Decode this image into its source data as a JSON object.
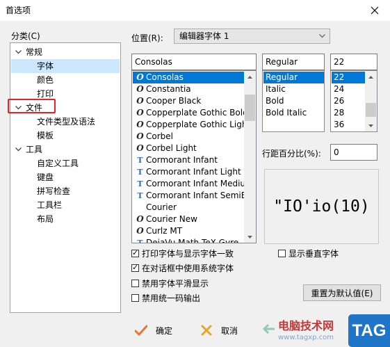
{
  "window": {
    "title": "首选项"
  },
  "category_label": "分类(C)",
  "tree": [
    {
      "label": "常规",
      "expanded": true,
      "items": [
        {
          "label": "字体",
          "selected": true
        },
        {
          "label": "颜色"
        },
        {
          "label": "打印"
        }
      ]
    },
    {
      "label": "文件",
      "expanded": true,
      "items": [
        {
          "label": "文件类型及语法"
        },
        {
          "label": "模板"
        }
      ]
    },
    {
      "label": "工具",
      "expanded": true,
      "items": [
        {
          "label": "自定义工具"
        },
        {
          "label": "键盘"
        },
        {
          "label": "拼写检查"
        },
        {
          "label": "工具栏"
        },
        {
          "label": "布局"
        }
      ]
    }
  ],
  "position": {
    "label": "位置(R):",
    "value": "编辑器字体 1"
  },
  "font": {
    "name_value": "Consolas",
    "list": [
      {
        "name": "Consolas",
        "icon": "opentype-icon",
        "selected": true
      },
      {
        "name": "Constantia",
        "icon": "opentype-icon"
      },
      {
        "name": "Cooper Black",
        "icon": "opentype-icon"
      },
      {
        "name": "Copperplate Gothic Bold",
        "icon": "opentype-icon"
      },
      {
        "name": "Copperplate Gothic Light",
        "icon": "opentype-icon"
      },
      {
        "name": "Corbel",
        "icon": "opentype-icon"
      },
      {
        "name": "Corbel Light",
        "icon": "opentype-icon"
      },
      {
        "name": "Cormorant Infant",
        "icon": "truetype-icon"
      },
      {
        "name": "Cormorant Infant Light",
        "icon": "truetype-icon"
      },
      {
        "name": "Cormorant Infant Medium",
        "icon": "truetype-icon"
      },
      {
        "name": "Cormorant Infant SemiBold",
        "icon": "truetype-icon"
      },
      {
        "name": "Courier",
        "icon": ""
      },
      {
        "name": "Courier New",
        "icon": "opentype-icon"
      },
      {
        "name": "Curlz MT",
        "icon": "opentype-icon"
      },
      {
        "name": "DejaVu Math TeX Gyre",
        "icon": "truetype-icon"
      }
    ]
  },
  "style": {
    "value": "Regular",
    "list": [
      {
        "name": "Regular",
        "selected": true
      },
      {
        "name": "Italic"
      },
      {
        "name": "Bold"
      },
      {
        "name": "Bold Italic"
      }
    ]
  },
  "size": {
    "value": "22",
    "list": [
      {
        "name": "22",
        "selected": true
      },
      {
        "name": "24"
      },
      {
        "name": "26"
      },
      {
        "name": "28"
      },
      {
        "name": "36"
      }
    ]
  },
  "line_spacing": {
    "label": "行距百分比(%):",
    "value": "0"
  },
  "preview_text": "\"IO'io(10)",
  "options": [
    {
      "label": "打印字体与显示字体一致",
      "checked": true
    },
    {
      "label": "在对话框中使用系统字体",
      "checked": true
    },
    {
      "label": "禁用字体平滑显示",
      "checked": false
    },
    {
      "label": "禁用统一码输出",
      "checked": false
    }
  ],
  "vertical_font": {
    "label": "显示垂直字体",
    "checked": false
  },
  "reset_button": "重置为默认值(E)",
  "footer": {
    "ok": "确定",
    "cancel": "取消"
  },
  "watermark": {
    "site": "电脑技术网",
    "url": "www.tagxp.com",
    "badge": "TAG"
  },
  "colors": {
    "selection": "#0078d7",
    "tree_selection": "#cce8ff",
    "highlight_box": "#e3242b"
  }
}
